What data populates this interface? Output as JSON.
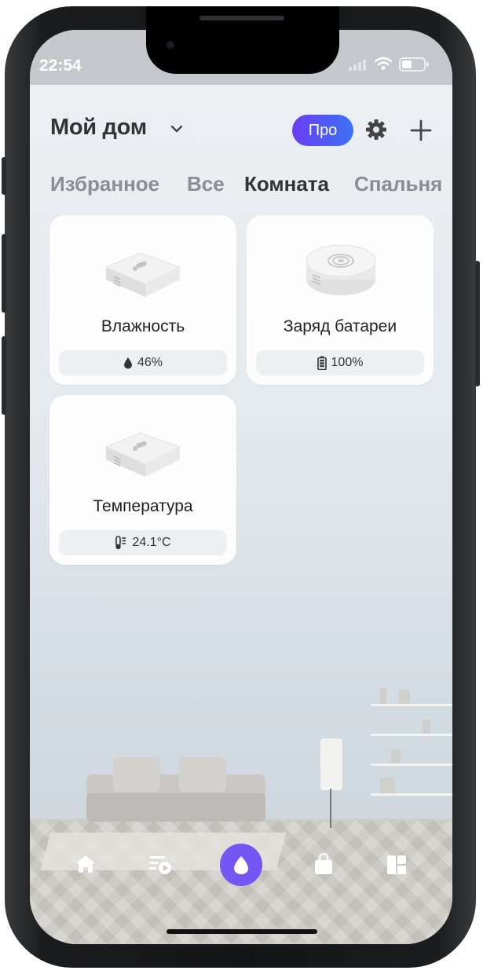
{
  "status": {
    "time": "22:54"
  },
  "header": {
    "title": "Мой дом",
    "pro_label": "Про"
  },
  "tabs": [
    {
      "label": "Избранное",
      "active": false
    },
    {
      "label": "Все",
      "active": false
    },
    {
      "label": "Комната",
      "active": true
    },
    {
      "label": "Спальня",
      "active": false
    }
  ],
  "devices": [
    {
      "name": "Влажность",
      "value": "46%",
      "icon": "droplet-icon",
      "device": "square-sensor"
    },
    {
      "name": "Заряд батареи",
      "value": "100%",
      "icon": "battery-icon",
      "device": "round-sensor"
    },
    {
      "name": "Температура",
      "value": "24.1°C",
      "icon": "thermometer-icon",
      "device": "square-sensor"
    }
  ],
  "nav": [
    "home-icon",
    "routines-icon",
    "alice-icon",
    "shop-icon",
    "services-icon"
  ],
  "colors": {
    "pro_gradient_start": "#6b3cf3",
    "pro_gradient_end": "#3a73f5",
    "alice": "#7257f4"
  }
}
